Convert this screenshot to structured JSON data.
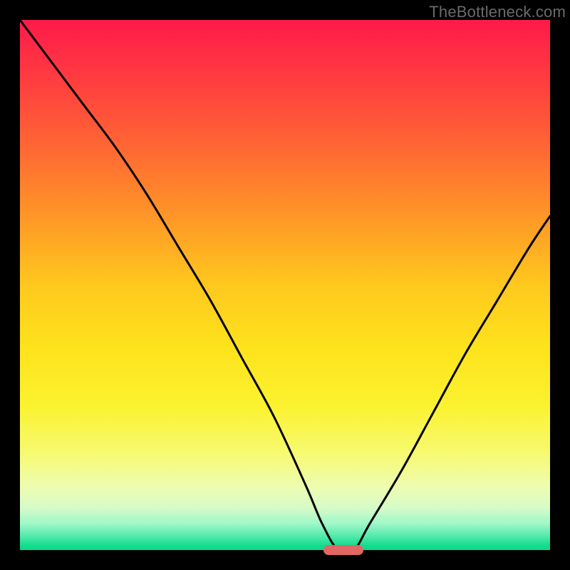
{
  "watermark": "TheBottleneck.com",
  "chart_data": {
    "type": "line",
    "title": "",
    "xlabel": "",
    "ylabel": "",
    "xlim": [
      0,
      100
    ],
    "ylim": [
      0,
      100
    ],
    "series": [
      {
        "name": "bottleneck-curve",
        "x": [
          0,
          6,
          12,
          18,
          24,
          30,
          36,
          42,
          48,
          54,
          57,
          60,
          63,
          66,
          72,
          78,
          84,
          90,
          96,
          100
        ],
        "values": [
          100,
          92,
          84,
          76,
          67,
          57,
          47,
          36,
          25,
          12,
          5,
          0,
          0,
          5,
          15,
          26,
          37,
          47,
          57,
          63
        ]
      }
    ],
    "marker": {
      "x": 61,
      "y": 0,
      "width_pct": 7.5,
      "color": "#e06764"
    }
  }
}
